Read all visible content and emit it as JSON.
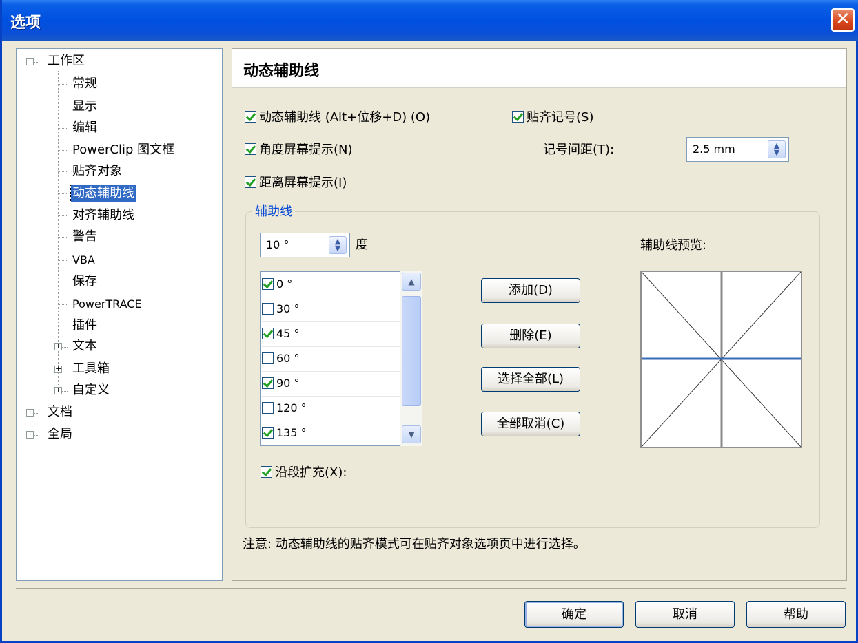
{
  "window": {
    "title": "选项",
    "close_symbol": "✕"
  },
  "tree": {
    "expand_symbol": "+",
    "collapse_symbol": "−",
    "items": [
      {
        "label": "工作区",
        "level": 0,
        "expander": "collapse"
      },
      {
        "label": "常规",
        "level": 1
      },
      {
        "label": "显示",
        "level": 1
      },
      {
        "label": "编辑",
        "level": 1
      },
      {
        "label": "PowerClip 图文框",
        "level": 1
      },
      {
        "label": "贴齐对象",
        "level": 1
      },
      {
        "label": "动态辅助线",
        "level": 1,
        "selected": true
      },
      {
        "label": "对齐辅助线",
        "level": 1
      },
      {
        "label": "警告",
        "level": 1
      },
      {
        "label": "VBA",
        "level": 1
      },
      {
        "label": "保存",
        "level": 1
      },
      {
        "label": "PowerTRACE",
        "level": 1
      },
      {
        "label": "插件",
        "level": 1
      },
      {
        "label": "文本",
        "level": 1,
        "expander": "expand"
      },
      {
        "label": "工具箱",
        "level": 1,
        "expander": "expand"
      },
      {
        "label": "自定义",
        "level": 1,
        "expander": "expand"
      },
      {
        "label": "文档",
        "level": 0,
        "expander": "expand"
      },
      {
        "label": "全局",
        "level": 0,
        "expander": "expand"
      }
    ]
  },
  "panel": {
    "title": "动态辅助线",
    "dynamic_guides": {
      "label": "动态辅助线 (Alt+位移+D) (O)",
      "checked": true
    },
    "snap_ticks": {
      "label": "贴齐记号(S)",
      "checked": true
    },
    "angle_tooltip": {
      "label": "角度屏幕提示(N)",
      "checked": true
    },
    "tick_spacing": {
      "label": "记号间距(T):",
      "value": "2.5 mm"
    },
    "distance_tooltip": {
      "label": "距离屏幕提示(I)",
      "checked": true
    },
    "guides_group": {
      "label": "辅助线",
      "angle_step": {
        "value": "10 °",
        "unit": "度"
      },
      "angles": [
        {
          "label": "0 °",
          "checked": true
        },
        {
          "label": "30 °",
          "checked": false
        },
        {
          "label": "45 °",
          "checked": true
        },
        {
          "label": "60 °",
          "checked": false
        },
        {
          "label": "90 °",
          "checked": true
        },
        {
          "label": "120 °",
          "checked": false
        },
        {
          "label": "135 °",
          "checked": true
        }
      ],
      "buttons": {
        "add": "添加(D)",
        "delete": "删除(E)",
        "select_all": "选择全部(L)",
        "deselect_all": "全部取消(C)"
      },
      "preview_label": "辅助线预览:",
      "extend_along_segment": {
        "label": "沿段扩充(X):",
        "checked": true
      }
    },
    "note": "注意: 动态辅助线的贴齐模式可在贴齐对象选项页中进行选择。"
  },
  "footer": {
    "ok": "确定",
    "cancel": "取消",
    "help": "帮助"
  },
  "colors": {
    "title_bar": "#0050e0",
    "selection": "#316ac5",
    "group_label": "#0046d5",
    "preview_highlight": "#3a6bb5",
    "checkmark": "#21a121"
  }
}
